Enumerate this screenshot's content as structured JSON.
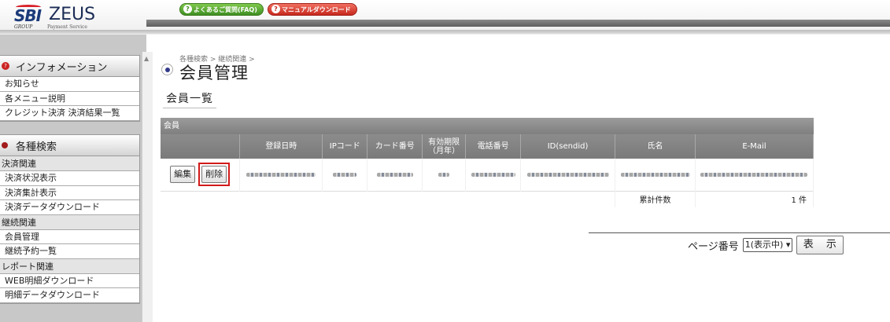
{
  "brand": {
    "sbi": "SBI",
    "group": "GROUP",
    "zeus": "ZEUS",
    "service": "Payment Service"
  },
  "header": {
    "faq_label": "よくあるご質問(FAQ)",
    "manual_label": "マニュアルダウンロード"
  },
  "sidebar": {
    "info": {
      "title": "インフォメーション",
      "items": [
        "お知らせ",
        "各メニュー説明",
        "クレジット決済 決済結果一覧"
      ]
    },
    "search": {
      "title": "各種検索",
      "groups": [
        {
          "label": "決済関連",
          "items": [
            "決済状況表示",
            "決済集計表示",
            "決済データダウンロード"
          ]
        },
        {
          "label": "継続関連",
          "items": [
            "会員管理",
            "継続予約一覧"
          ]
        },
        {
          "label": "レポート関連",
          "items": [
            "WEB明細ダウンロード",
            "明細データダウンロード"
          ]
        }
      ]
    }
  },
  "main": {
    "breadcrumb": "各種検索 > 継続関連 >",
    "title": "会員管理",
    "section_title": "会員一覧",
    "table": {
      "caption": "会員",
      "headers": [
        "",
        "登録日時",
        "IPコード",
        "カード番号",
        "有効期限\n（月年）",
        "電話番号",
        "ID(sendid)",
        "氏名",
        "E-Mail"
      ],
      "row_actions": {
        "edit": "編集",
        "delete": "削除"
      },
      "total_label": "累計件数",
      "total_value": "1 件"
    },
    "pager": {
      "label": "ページ番号",
      "selected": "1(表示中)",
      "show_button": "表 示"
    }
  }
}
